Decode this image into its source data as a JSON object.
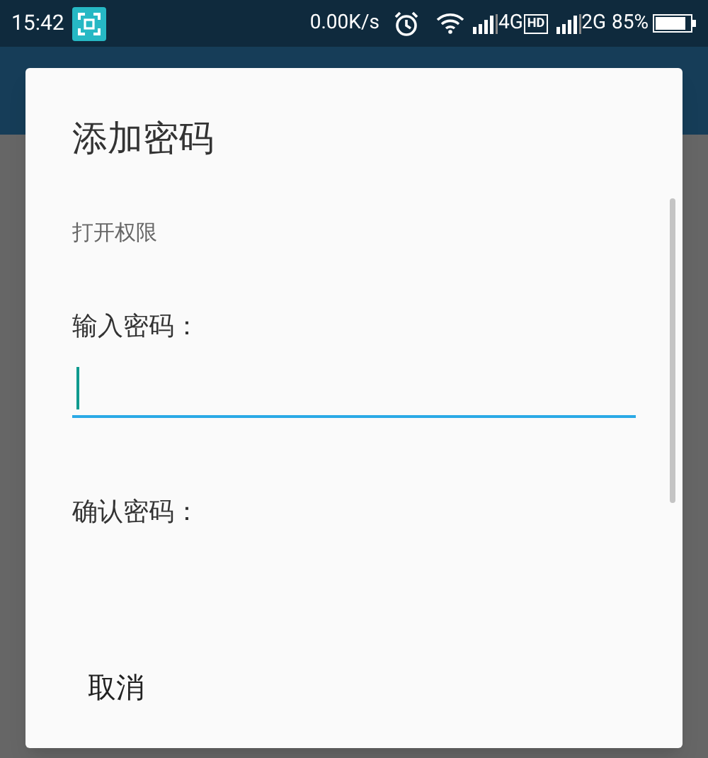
{
  "status_bar": {
    "time": "15:42",
    "network_speed": "0.00K/s",
    "network_1": "4G",
    "hd": "HD",
    "network_2": "2G",
    "battery": "85%"
  },
  "dialog": {
    "title": "添加密码",
    "subtitle": "打开权限",
    "password_label": "输入密码：",
    "password_field": {
      "focused": true
    },
    "confirm_label": "确认密码：",
    "buttons": [
      "取消"
    ]
  }
}
